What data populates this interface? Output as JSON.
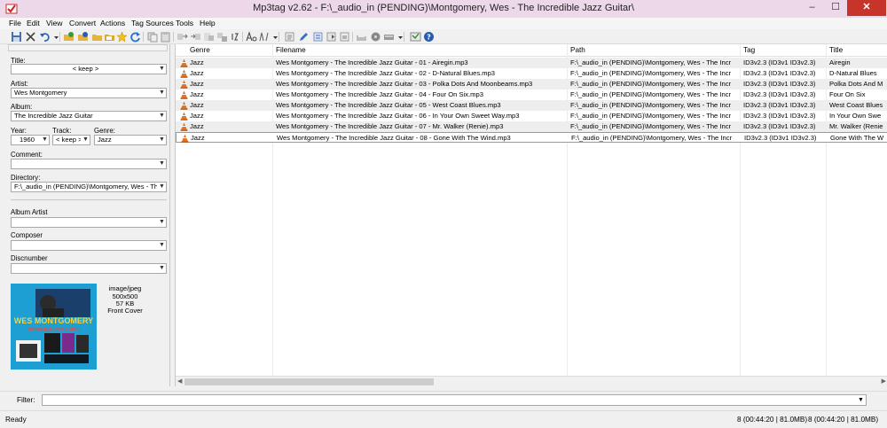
{
  "window": {
    "title": "Mp3tag v2.62  -  F:\\_audio_in (PENDING)\\Montgomery, Wes - The Incredible Jazz Guitar\\",
    "minimize_glyph": "–",
    "maximize_glyph": "☐",
    "close_glyph": "✕"
  },
  "menu": [
    "File",
    "Edit",
    "View",
    "Convert",
    "Actions",
    "Tag Sources",
    "Tools",
    "Help"
  ],
  "toolbar_icons": [
    "save-icon",
    "remove-tag-icon",
    "undo-icon",
    "undo-dropdown-icon",
    "add-directory-icon",
    "change-directory-icon",
    "open-folder-icon",
    "folder-icon",
    "favorites-star-icon",
    "refresh-icon",
    "copy-tag-icon",
    "paste-tag-icon",
    "tag-to-filename-icon",
    "filename-to-tag-icon",
    "text-to-tag-icon",
    "tag-to-tag-icon",
    "autonumbering-icon",
    "case-conversion-icon",
    "actions-icon",
    "actions-dropdown-icon",
    "export-icon",
    "edit-icon",
    "playlist-icon",
    "freedb-icon",
    "discogs-icon",
    "amazon-icon",
    "musicbrainz-icon",
    "tag-sources-dropdown-icon",
    "options-icon",
    "help-icon"
  ],
  "tag_panel": {
    "title_label": "Title:",
    "title_value": "< keep >",
    "artist_label": "Artist:",
    "artist_value": "Wes Montgomery",
    "album_label": "Album:",
    "album_value": "The Incredible Jazz Guitar",
    "year_label": "Year:",
    "year_value": "1960",
    "track_label": "Track:",
    "track_value": "< keep >",
    "genre_label": "Genre:",
    "genre_value": "Jazz",
    "comment_label": "Comment:",
    "comment_value": "",
    "directory_label": "Directory:",
    "directory_value": "F:\\_audio_in (PENDING)\\Montgomery, Wes - The Incredible Jazz Guitar",
    "album_artist_label": "Album Artist",
    "album_artist_value": "",
    "composer_label": "Composer",
    "composer_value": "",
    "discnumber_label": "Discnumber",
    "discnumber_value": "",
    "cover": {
      "mime": "image/jpeg",
      "dimensions": "500x500",
      "size": "57 KB",
      "type": "Front Cover",
      "art_artist": "WES MONTGOMERY",
      "art_subtitle": "INCREDIBLE JAZZ GUITAR"
    }
  },
  "file_list": {
    "columns": [
      "Genre",
      "Filename",
      "Path",
      "Tag",
      "Title"
    ],
    "rows": [
      {
        "genre": "Jazz",
        "filename": "Wes Montgomery - The Incredible Jazz Guitar - 01 - Airegin.mp3",
        "path": "F:\\_audio_in (PENDING)\\Montgomery, Wes - The Incr",
        "tag": "ID3v2.3 (ID3v1 ID3v2.3)",
        "title": "Airegin"
      },
      {
        "genre": "Jazz",
        "filename": "Wes Montgomery - The Incredible Jazz Guitar - 02 - D-Natural Blues.mp3",
        "path": "F:\\_audio_in (PENDING)\\Montgomery, Wes - The Incr",
        "tag": "ID3v2.3 (ID3v1 ID3v2.3)",
        "title": "D-Natural Blues"
      },
      {
        "genre": "Jazz",
        "filename": "Wes Montgomery - The Incredible Jazz Guitar - 03 - Polka Dots And Moonbeams.mp3",
        "path": "F:\\_audio_in (PENDING)\\Montgomery, Wes - The Incr",
        "tag": "ID3v2.3 (ID3v1 ID3v2.3)",
        "title": "Polka Dots And M"
      },
      {
        "genre": "Jazz",
        "filename": "Wes Montgomery - The Incredible Jazz Guitar - 04 - Four On Six.mp3",
        "path": "F:\\_audio_in (PENDING)\\Montgomery, Wes - The Incr",
        "tag": "ID3v2.3 (ID3v1 ID3v2.3)",
        "title": "Four On Six"
      },
      {
        "genre": "Jazz",
        "filename": "Wes Montgomery - The Incredible Jazz Guitar - 05 - West Coast Blues.mp3",
        "path": "F:\\_audio_in (PENDING)\\Montgomery, Wes - The Incr",
        "tag": "ID3v2.3 (ID3v1 ID3v2.3)",
        "title": "West Coast Blues"
      },
      {
        "genre": "Jazz",
        "filename": "Wes Montgomery - The Incredible Jazz Guitar - 06 - In Your Own Sweet Way.mp3",
        "path": "F:\\_audio_in (PENDING)\\Montgomery, Wes - The Incr",
        "tag": "ID3v2.3 (ID3v1 ID3v2.3)",
        "title": "In Your Own Swe"
      },
      {
        "genre": "Jazz",
        "filename": "Wes Montgomery - The Incredible Jazz Guitar - 07 - Mr. Walker (Renie).mp3",
        "path": "F:\\_audio_in (PENDING)\\Montgomery, Wes - The Incr",
        "tag": "ID3v2.3 (ID3v1 ID3v2.3)",
        "title": "Mr. Walker (Renie"
      },
      {
        "genre": "Jazz",
        "filename": "Wes Montgomery - The Incredible Jazz Guitar - 08 - Gone With The Wind.mp3",
        "path": "F:\\_audio_in (PENDING)\\Montgomery, Wes - The Incr",
        "tag": "ID3v2.3 (ID3v1 ID3v2.3)",
        "title": "Gone With The W"
      }
    ]
  },
  "filter": {
    "label": "Filter:",
    "value": ""
  },
  "status": {
    "left": "Ready",
    "selected": "8 (00:44:20 | 81.0MB)",
    "total": "8 (00:44:20 | 81.0MB)"
  },
  "colors": {
    "titlebar": "#ecd8e8",
    "close_button": "#c7352a",
    "cover_background": "#1e9fd3",
    "cover_text": "#f5d23a",
    "file_icon": "#e8731c"
  }
}
